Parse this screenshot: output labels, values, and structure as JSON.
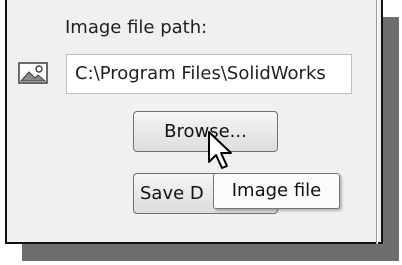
{
  "dialog": {
    "image_path_label": "Image file path:",
    "image_path_value": "C:\\Program Files\\SolidWorks",
    "browse_label": "Browse...",
    "save_label": "Save D",
    "tooltip": "Image file"
  },
  "icons": {
    "image": "image-icon",
    "cursor": "mouse-pointer-icon"
  },
  "colors": {
    "panel": "#f0f0f0",
    "shadow": "#6e6e6e",
    "border": "#111111"
  }
}
